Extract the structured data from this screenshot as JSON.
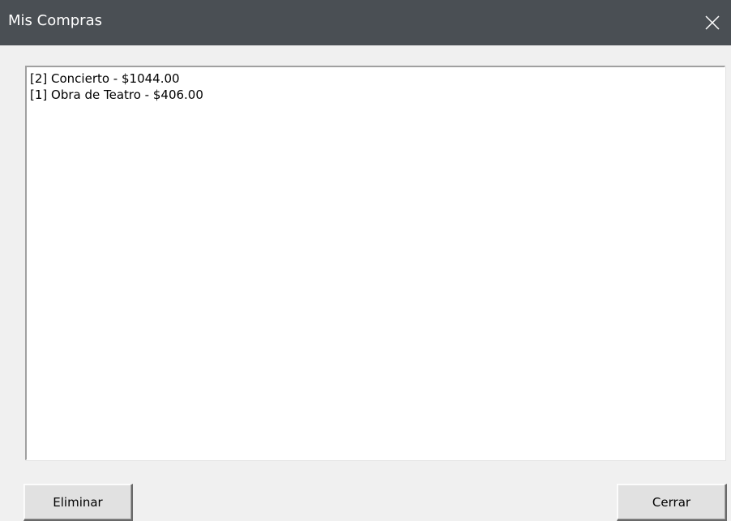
{
  "window": {
    "title": "Mis Compras",
    "close_icon": "close-icon"
  },
  "purchases": {
    "items": [
      {
        "label": "[2] Concierto - $1044.00"
      },
      {
        "label": "[1] Obra de Teatro - $406.00"
      }
    ]
  },
  "buttons": {
    "eliminar_label": "Eliminar",
    "cerrar_label": "Cerrar"
  },
  "colors": {
    "titlebar": "#4a4f54",
    "window_background": "#f0f0f0",
    "list_background": "#ffffff",
    "button_face": "#e1e1e1"
  }
}
